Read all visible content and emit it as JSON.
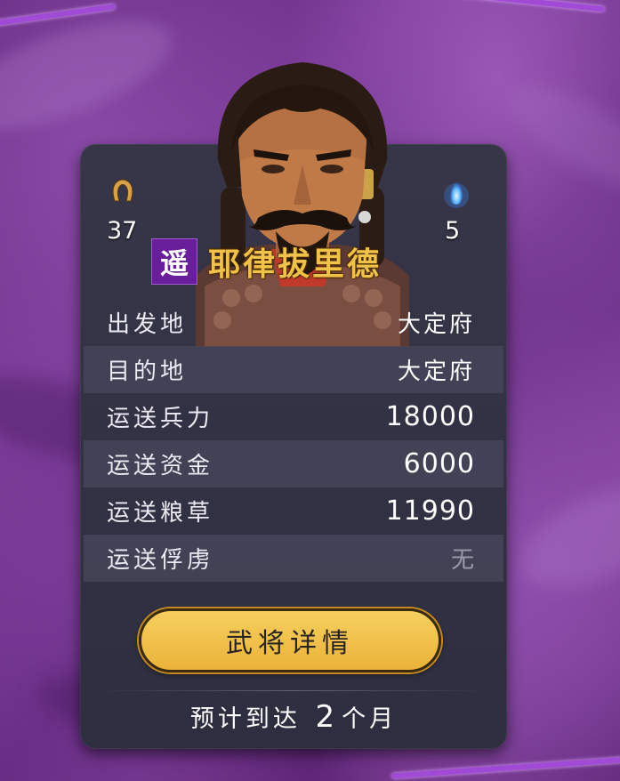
{
  "general": {
    "faction_char": "遥",
    "name": "耶律拔里德",
    "left_stat": "37",
    "right_stat": "5",
    "left_icon": "horseshoe-icon",
    "right_icon": "blue-flame-icon"
  },
  "transport": {
    "rows": [
      {
        "label": "出发地",
        "value": "大定府"
      },
      {
        "label": "目的地",
        "value": "大定府"
      },
      {
        "label": "运送兵力",
        "value": "18000"
      },
      {
        "label": "运送资金",
        "value": "6000"
      },
      {
        "label": "运送粮草",
        "value": "11990"
      },
      {
        "label": "运送俘虏",
        "value": "无"
      }
    ]
  },
  "actions": {
    "detail_button": "武将详情"
  },
  "eta": {
    "prefix": "预计到达",
    "number": "2",
    "suffix": "个月"
  },
  "colors": {
    "panel": "#2e2e40",
    "accent_gold": "#f1c24a",
    "button": "#eab33a",
    "faction": "#6a1f9a"
  }
}
